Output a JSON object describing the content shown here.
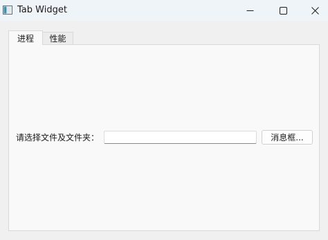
{
  "window": {
    "title": "Tab Widget"
  },
  "tabs": [
    {
      "label": "进程",
      "active": true
    },
    {
      "label": "性能",
      "active": false
    }
  ],
  "form": {
    "label": "请选择文件及文件夹：",
    "input_value": "",
    "button_label": "消息框..."
  },
  "icons": {
    "app": "window-app-icon",
    "minimize": "minimize-icon",
    "maximize": "maximize-icon",
    "close": "close-icon"
  },
  "colors": {
    "titlebar": "#eff4f9",
    "window_bg": "#f0f0f0",
    "panel_bg": "#f9f9f9",
    "border": "#d9d9d9"
  }
}
